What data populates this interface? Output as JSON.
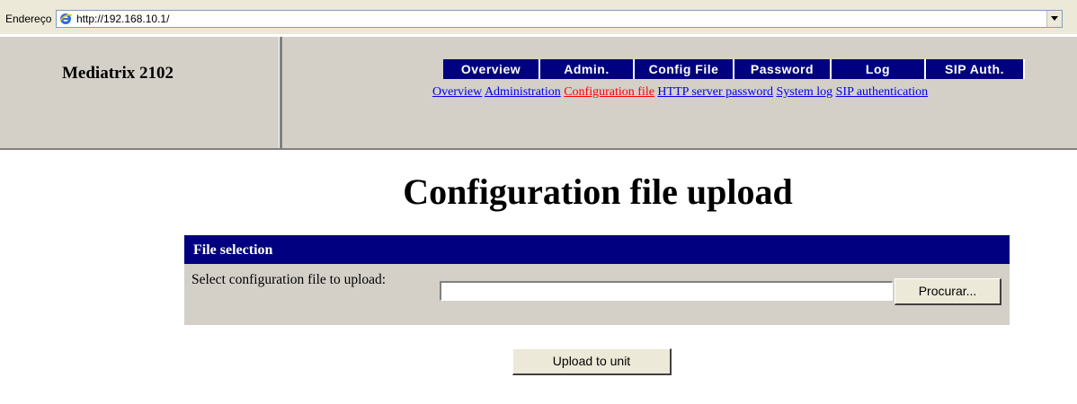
{
  "browser": {
    "address_label": "Endereço",
    "url": "http://192.168.10.1/"
  },
  "header": {
    "product_name": "Mediatrix 2102",
    "nav_buttons": [
      {
        "label": "Overview"
      },
      {
        "label": "Admin."
      },
      {
        "label": "Config File"
      },
      {
        "label": "Password"
      },
      {
        "label": "Log"
      },
      {
        "label": "SIP Auth."
      }
    ],
    "nav_links": [
      {
        "label": "Overview",
        "active": false
      },
      {
        "label": "Administration",
        "active": false
      },
      {
        "label": "Configuration file",
        "active": true
      },
      {
        "label": "HTTP server password",
        "active": false
      },
      {
        "label": "System log",
        "active": false
      },
      {
        "label": "SIP authentication",
        "active": false
      }
    ]
  },
  "main": {
    "title": "Configuration file upload",
    "file_selection": {
      "header": "File selection",
      "row_label": "Select configuration file to upload:",
      "file_value": "",
      "browse_label": "Procurar..."
    },
    "upload_button": "Upload to unit"
  },
  "colors": {
    "nav_bg": "#000080",
    "frame_bg": "#d4d0c8",
    "active_link": "#ff0000",
    "link": "#0000ee"
  },
  "icons": {
    "browser_icon": "ie-icon",
    "dropdown_icon": "chevron-down-icon"
  }
}
